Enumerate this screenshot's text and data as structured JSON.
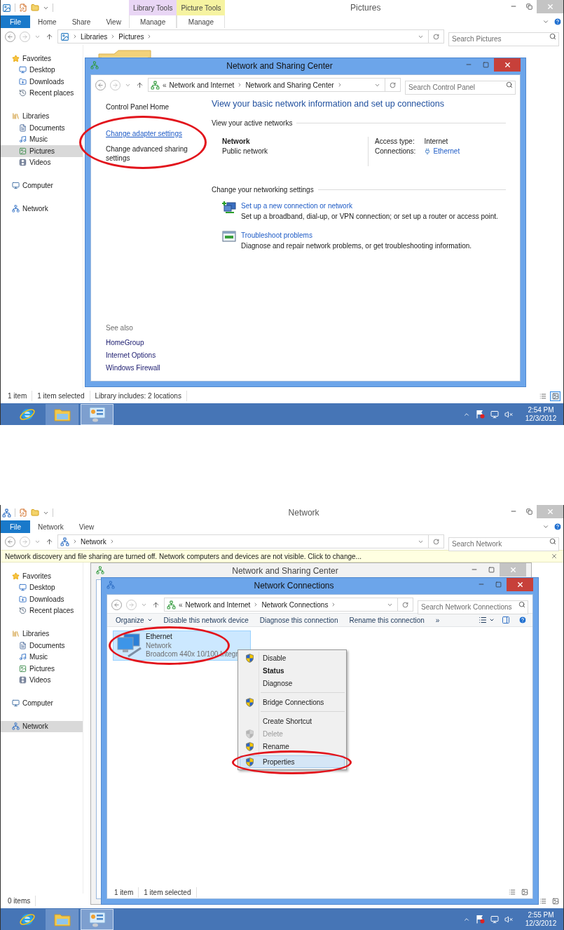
{
  "screens": [
    {
      "explorer": {
        "title": "Pictures",
        "active": false,
        "ribbon_tabs": [
          {
            "label": "File",
            "kind": "file"
          },
          {
            "label": "Home",
            "kind": "tab"
          },
          {
            "label": "Share",
            "kind": "tab"
          },
          {
            "label": "View",
            "kind": "tab"
          },
          {
            "label": "Manage",
            "kind": "context",
            "group": "Library Tools",
            "color": "#e9d6f5"
          },
          {
            "label": "Manage",
            "kind": "context",
            "group": "Picture Tools",
            "color": "#f6f3a1"
          }
        ],
        "address": {
          "kind": "library",
          "crumbs": [
            "Libraries",
            "Pictures"
          ]
        },
        "search": {
          "placeholder": "Search Pictures"
        },
        "nav": [
          {
            "label": "Favorites",
            "kind": "favorites",
            "selected": false,
            "children": [
              {
                "label": "Desktop",
                "kind": "desktop",
                "selected": false
              },
              {
                "label": "Downloads",
                "kind": "downloads",
                "selected": false
              },
              {
                "label": "Recent places",
                "kind": "recent",
                "selected": false
              }
            ]
          },
          {
            "label": "Libraries",
            "kind": "libraries",
            "selected": false,
            "children": [
              {
                "label": "Documents",
                "kind": "documents",
                "selected": false
              },
              {
                "label": "Music",
                "kind": "music",
                "selected": false
              },
              {
                "label": "Pictures",
                "kind": "pictures",
                "selected": true
              },
              {
                "label": "Videos",
                "kind": "videos",
                "selected": false
              }
            ]
          },
          {
            "label": "Computer",
            "kind": "computer",
            "selected": false
          },
          {
            "label": "Network",
            "kind": "network",
            "selected": false
          }
        ],
        "items": [
          {
            "kind": "folder"
          }
        ],
        "status": [
          "1 item",
          "1 item selected",
          "Library includes: 2 locations"
        ],
        "views": [
          {
            "kind": "details",
            "selected": false
          },
          {
            "kind": "thumbnails",
            "selected": true
          }
        ]
      },
      "windows": [
        {
          "kind": "sharing_center",
          "title": "Network and Sharing Center",
          "active": true,
          "address": {
            "kind": "control_panel",
            "overflow": "«",
            "crumbs": [
              "Network and Internet",
              "Network and Sharing Center"
            ]
          },
          "search": {
            "placeholder": "Search Control Panel"
          },
          "body": {
            "sidebar": [
              {
                "label": "Control Panel Home",
                "kind": "plain"
              },
              {
                "label": "Change adapter settings",
                "kind": "link",
                "circled": true
              },
              {
                "label": "Change advanced sharing settings",
                "kind": "plain"
              }
            ],
            "heading": "View your basic network information and set up connections",
            "active_networks": {
              "title": "View your active networks",
              "name": "Network",
              "type": "Public network",
              "properties": [
                {
                  "label": "Access type:",
                  "value": "Internet",
                  "kind": "text"
                },
                {
                  "label": "Connections:",
                  "value": "Ethernet",
                  "kind": "link"
                }
              ]
            },
            "settings": {
              "title": "Change your networking settings",
              "tasks": [
                {
                  "kind": "new_connection",
                  "title": "Set up a new connection or network",
                  "description": "Set up a broadband, dial-up, or VPN connection; or set up a router or access point."
                },
                {
                  "kind": "troubleshoot",
                  "title": "Troubleshoot problems",
                  "description": "Diagnose and repair network problems, or get troubleshooting information."
                }
              ]
            },
            "see_also": {
              "title": "See also",
              "links": [
                "HomeGroup",
                "Internet Options",
                "Windows Firewall"
              ]
            }
          }
        }
      ],
      "taskbar": {
        "apps": [
          {
            "kind": "browser",
            "running": false,
            "selected": false
          },
          {
            "kind": "explorer",
            "running": true,
            "selected": false
          },
          {
            "kind": "control_panel",
            "running": true,
            "selected": true
          }
        ],
        "time": "2:54 PM",
        "date": "12/3/2012"
      }
    },
    {
      "explorer": {
        "title": "Network",
        "active": false,
        "ribbon_tabs": [
          {
            "label": "File",
            "kind": "file"
          },
          {
            "label": "Network",
            "kind": "tab"
          },
          {
            "label": "View",
            "kind": "tab"
          }
        ],
        "address": {
          "kind": "network",
          "crumbs": [
            "Network"
          ]
        },
        "search": {
          "placeholder": "Search Network"
        },
        "infobar": {
          "text": "Network discovery and file sharing are turned off. Network computers and devices are not visible. Click to change..."
        },
        "nav": [
          {
            "label": "Favorites",
            "kind": "favorites",
            "selected": false,
            "children": [
              {
                "label": "Desktop",
                "kind": "desktop",
                "selected": false
              },
              {
                "label": "Downloads",
                "kind": "downloads",
                "selected": false
              },
              {
                "label": "Recent places",
                "kind": "recent",
                "selected": false
              }
            ]
          },
          {
            "label": "Libraries",
            "kind": "libraries",
            "selected": false,
            "children": [
              {
                "label": "Documents",
                "kind": "documents",
                "selected": false
              },
              {
                "label": "Music",
                "kind": "music",
                "selected": false
              },
              {
                "label": "Pictures",
                "kind": "pictures",
                "selected": false
              },
              {
                "label": "Videos",
                "kind": "videos",
                "selected": false
              }
            ]
          },
          {
            "label": "Computer",
            "kind": "computer",
            "selected": false
          },
          {
            "label": "Network",
            "kind": "network",
            "selected": true
          }
        ],
        "status": [
          "0 items"
        ],
        "views": [
          {
            "kind": "details",
            "selected": false
          },
          {
            "kind": "thumbnails",
            "selected": false
          }
        ]
      },
      "windows": [
        {
          "kind": "sharing_center",
          "title": "Network and Sharing Center",
          "active": false
        },
        {
          "kind": "connections",
          "title": "Network Connections",
          "active": true,
          "address": {
            "kind": "control_panel",
            "overflow": "«",
            "crumbs": [
              "Network and Internet",
              "Network Connections"
            ]
          },
          "search": {
            "placeholder": "Search Network Connections"
          },
          "commands": [
            {
              "label": "Organize",
              "dropdown": true
            },
            {
              "label": "Disable this network device",
              "dropdown": false
            },
            {
              "label": "Diagnose this connection",
              "dropdown": false
            },
            {
              "label": "Rename this connection",
              "dropdown": false
            }
          ],
          "more": "»",
          "connections": [
            {
              "name": "Ethernet",
              "network": "Network",
              "adapter": "Broadcom 440x 10/100 Integr",
              "selected": true,
              "circled": true
            }
          ],
          "status": [
            "1 item",
            "1 item selected"
          ],
          "views": [
            {
              "kind": "details",
              "selected": false
            },
            {
              "kind": "thumbnails",
              "selected": false
            }
          ]
        }
      ],
      "context_menu": {
        "items": [
          {
            "kind": "shield",
            "label": "Disable",
            "default": false,
            "disabled": false,
            "selected": false
          },
          {
            "kind": "plain",
            "label": "Status",
            "default": true,
            "disabled": false,
            "selected": false
          },
          {
            "kind": "plain",
            "label": "Diagnose",
            "default": false,
            "disabled": false,
            "selected": false
          },
          {
            "kind": "separator"
          },
          {
            "kind": "shield",
            "label": "Bridge Connections",
            "default": false,
            "disabled": false,
            "selected": false
          },
          {
            "kind": "separator"
          },
          {
            "kind": "plain",
            "label": "Create Shortcut",
            "default": false,
            "disabled": false,
            "selected": false
          },
          {
            "kind": "shield",
            "label": "Delete",
            "default": false,
            "disabled": true,
            "selected": false
          },
          {
            "kind": "shield",
            "label": "Rename",
            "default": false,
            "disabled": false,
            "selected": false
          },
          {
            "kind": "shield",
            "label": "Properties",
            "default": false,
            "disabled": false,
            "selected": true,
            "circled": true
          }
        ]
      },
      "taskbar": {
        "apps": [
          {
            "kind": "browser",
            "running": false,
            "selected": false
          },
          {
            "kind": "explorer",
            "running": true,
            "selected": false
          },
          {
            "kind": "control_panel",
            "running": true,
            "selected": true
          }
        ],
        "time": "2:55 PM",
        "date": "12/3/2012"
      }
    }
  ]
}
